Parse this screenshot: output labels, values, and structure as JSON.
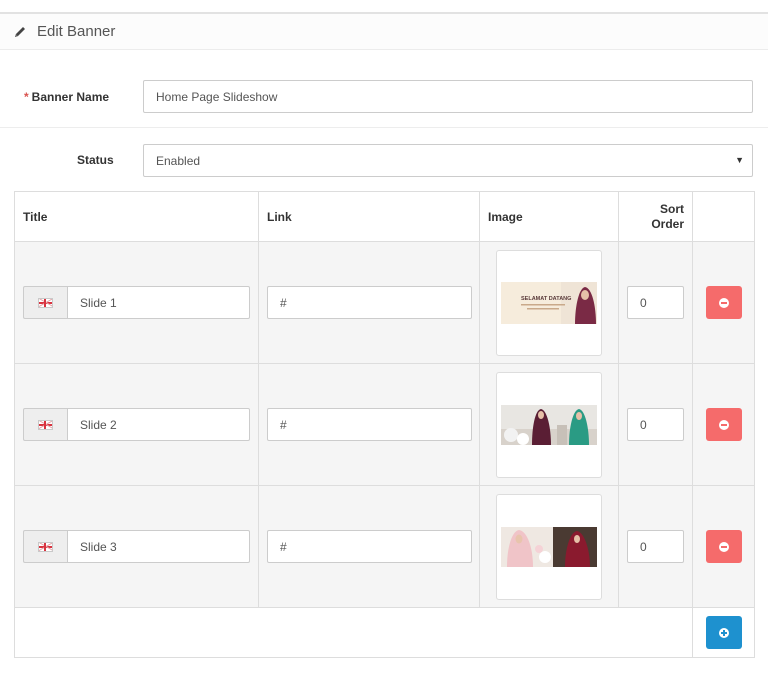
{
  "header": {
    "title": "Edit Banner",
    "icon": "pencil-icon"
  },
  "form": {
    "name_required_mark": "*",
    "name_label": "Banner Name",
    "name_value": "Home Page Slideshow",
    "status_label": "Status",
    "status_value": "Enabled"
  },
  "table": {
    "columns": {
      "title": "Title",
      "link": "Link",
      "image": "Image",
      "sort_order": "Sort Order"
    },
    "rows": [
      {
        "title": "Slide 1",
        "link": "#",
        "sort_order": "0"
      },
      {
        "title": "Slide 2",
        "link": "#",
        "sort_order": "0"
      },
      {
        "title": "Slide 3",
        "link": "#",
        "sort_order": "0"
      }
    ],
    "slide1_caption": "SELAMAT DATANG"
  },
  "colors": {
    "danger": "#f56b6b",
    "primary": "#1e91cf",
    "required": "#d9534f"
  }
}
